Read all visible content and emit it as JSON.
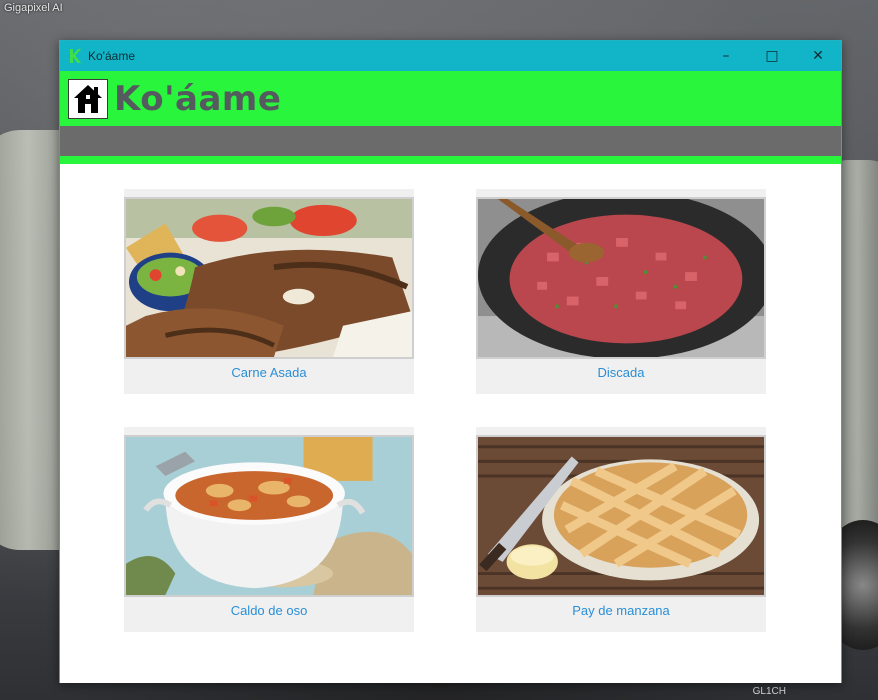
{
  "desktop": {
    "top_left_label": "Gigapixel AI",
    "bottom_right_label": "GL1CH"
  },
  "window": {
    "title": "Ko'áame",
    "controls": {
      "minimize": "–",
      "maximize": "□",
      "close": "✕"
    }
  },
  "header": {
    "brand": "Ko'áame",
    "home_icon": "home-icon"
  },
  "colors": {
    "titlebar": "#12b4c7",
    "header_green": "#29f53d",
    "gray_bar": "#6b6b6b",
    "label_blue": "#2a8fd6",
    "brand_text": "#555a5e"
  },
  "dishes": [
    {
      "label": "Carne Asada",
      "image": "carne-asada-photo"
    },
    {
      "label": "Discada",
      "image": "discada-photo"
    },
    {
      "label": "Caldo de oso",
      "image": "caldo-de-oso-photo"
    },
    {
      "label": "Pay de manzana",
      "image": "pay-de-manzana-photo"
    }
  ]
}
